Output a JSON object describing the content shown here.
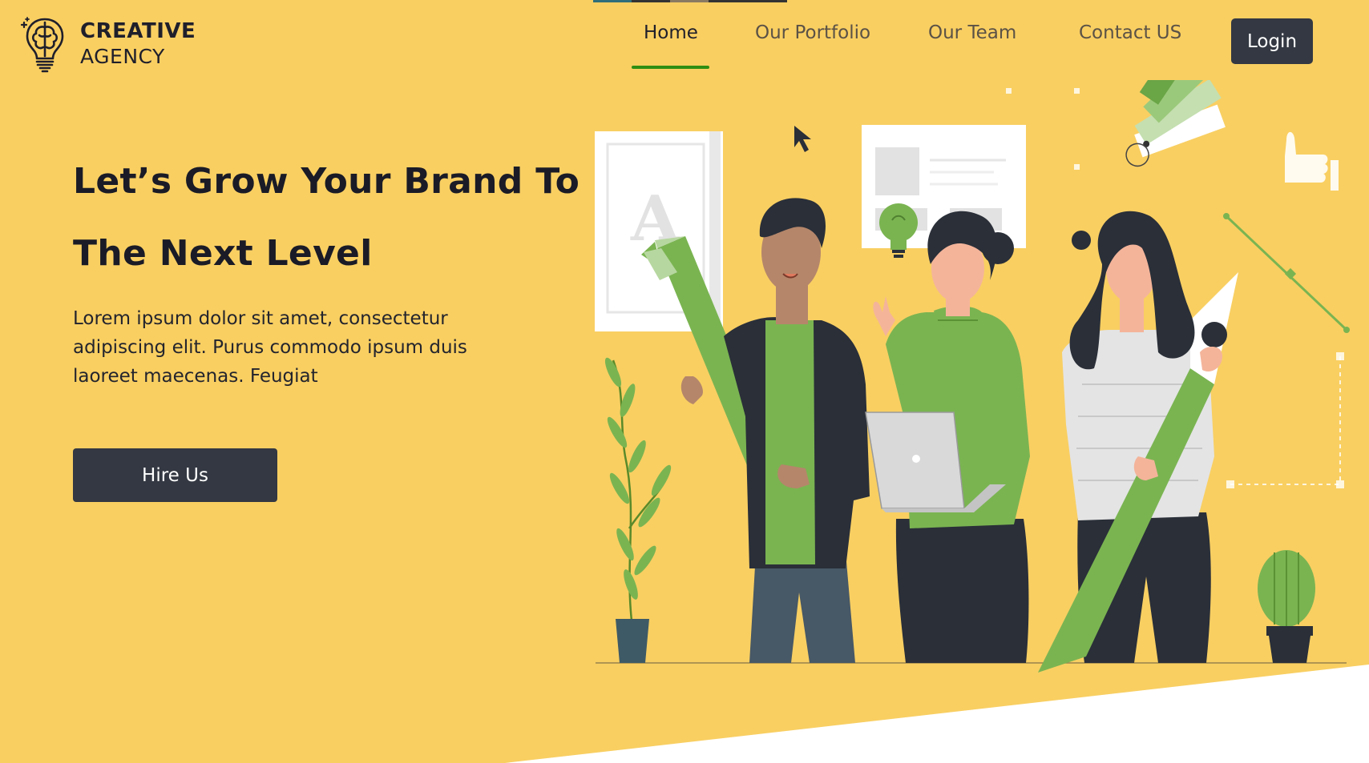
{
  "brand": {
    "line1": "CREATIVE",
    "line2": "AGENCY",
    "logo_icon": "brain-bulb-icon"
  },
  "nav": {
    "items": [
      {
        "label": "Home",
        "active": true
      },
      {
        "label": "Our Portfolio",
        "active": false
      },
      {
        "label": "Our Team",
        "active": false
      },
      {
        "label": "Contact US",
        "active": false
      }
    ],
    "login_label": "Login"
  },
  "hero": {
    "headline_line1": "Let’s Grow Your Brand To",
    "headline_line2": "The Next Level",
    "description": "Lorem ipsum dolor sit amet, consectetur adipiscing elit. Purus commodo ipsum duis laoreet maecenas. Feugiat",
    "cta_label": "Hire Us",
    "illustration_letter": "A"
  },
  "colors": {
    "background": "#f9cf62",
    "button": "#333842",
    "accent_green": "#7ab451",
    "nav_underline": "#2f8e12",
    "text_dark": "#1a1b26"
  }
}
